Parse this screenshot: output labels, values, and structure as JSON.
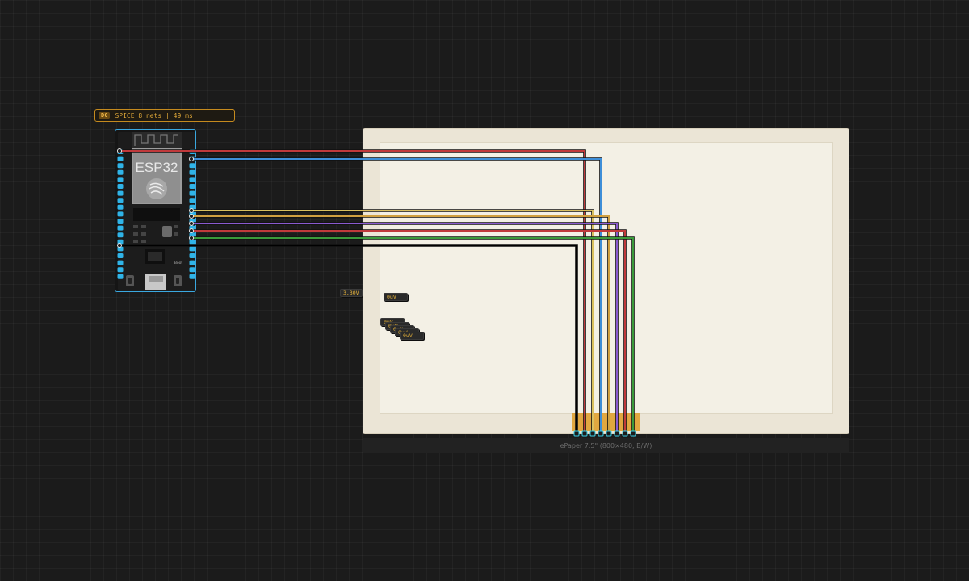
{
  "simulator": {
    "mode_tag": "DC",
    "status": "SPICE 8 nets | 49 ms"
  },
  "mcu": {
    "name": "ESP32",
    "button_labels": [
      "EN",
      "Boot"
    ]
  },
  "display": {
    "caption": "ePaper 7.5\" (800×480, B/W)"
  },
  "probes": [
    "3.30V",
    "0uV",
    "0uV",
    "0uV",
    "0uV",
    "0uV",
    "0uV"
  ],
  "colors": {
    "background": "#1b1b1b",
    "accent": "#e0a838",
    "select": "#3aa8e0",
    "wire_red": "#c0393b",
    "wire_blue": "#3d8ed8",
    "wire_yellow": "#d9c060",
    "wire_orange": "#d0a040",
    "wire_purple": "#8a5ad0",
    "wire_green": "#3a9a3a",
    "wire_black": "#000000",
    "connector": "#e0a030"
  }
}
